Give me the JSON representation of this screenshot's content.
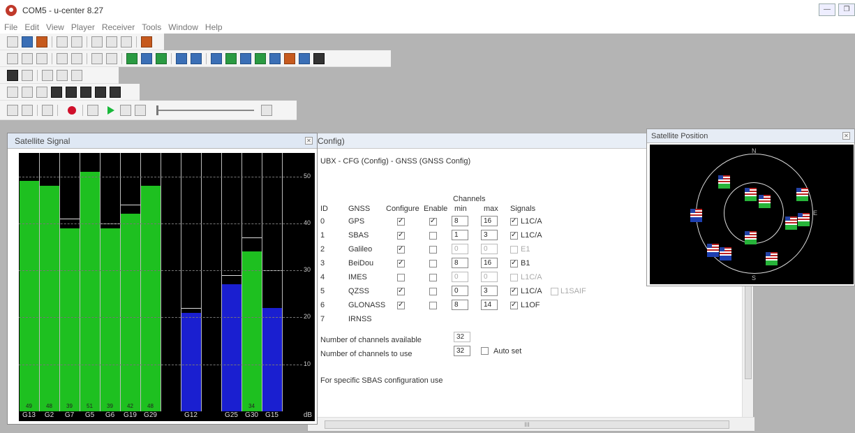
{
  "window": {
    "title": "COM5 - u-center 8.27"
  },
  "menu": [
    "File",
    "Edit",
    "View",
    "Player",
    "Receiver",
    "Tools",
    "Window",
    "Help"
  ],
  "config": {
    "title": "Config)",
    "heading": "UBX - CFG (Config) - GNSS (GNSS Config)",
    "channels_label": "Channels",
    "columns": [
      "ID",
      "GNSS",
      "Configure",
      "Enable",
      "min",
      "max",
      "Signals"
    ],
    "rows": [
      {
        "id": "0",
        "gnss": "GPS",
        "configure": true,
        "enable": true,
        "min": "8",
        "max": "16",
        "signal": "L1C/A",
        "signal_on": true,
        "disabled": false
      },
      {
        "id": "1",
        "gnss": "SBAS",
        "configure": true,
        "enable": false,
        "min": "1",
        "max": "3",
        "signal": "L1C/A",
        "signal_on": true,
        "disabled": false
      },
      {
        "id": "2",
        "gnss": "Galileo",
        "configure": true,
        "enable": false,
        "min": "0",
        "max": "0",
        "signal": "E1",
        "signal_on": false,
        "disabled": true
      },
      {
        "id": "3",
        "gnss": "BeiDou",
        "configure": true,
        "enable": false,
        "min": "8",
        "max": "16",
        "signal": "B1",
        "signal_on": true,
        "disabled": false
      },
      {
        "id": "4",
        "gnss": "IMES",
        "configure": false,
        "enable": false,
        "min": "0",
        "max": "0",
        "signal": "L1C/A",
        "signal_on": false,
        "disabled": true
      },
      {
        "id": "5",
        "gnss": "QZSS",
        "configure": true,
        "enable": false,
        "min": "0",
        "max": "3",
        "signal": "L1C/A",
        "signal_on": true,
        "disabled": false,
        "extra_signal": "L1SAIF"
      },
      {
        "id": "6",
        "gnss": "GLONASS",
        "configure": true,
        "enable": false,
        "min": "8",
        "max": "14",
        "signal": "L1OF",
        "signal_on": true,
        "disabled": false
      },
      {
        "id": "7",
        "gnss": "IRNSS",
        "configure": null,
        "enable": null,
        "min": null,
        "max": null,
        "signal": null,
        "disabled": false
      }
    ],
    "channels_available_label": "Number of channels available",
    "channels_available": "32",
    "channels_use_label": "Number of channels to use",
    "channels_use": "32",
    "auto_set_label": "Auto set",
    "sbas_note": "For specific SBAS configuration use",
    "hscroll_label": "III"
  },
  "signal": {
    "title": "Satellite Signal",
    "x_unit": "dB",
    "y_ticks": [
      "50",
      "40",
      "30",
      "20",
      "10"
    ]
  },
  "position": {
    "title": "Satellite Position",
    "dirs": {
      "n": "N",
      "e": "E",
      "s": "S"
    }
  },
  "chart_data": {
    "type": "bar",
    "categories": [
      "G13",
      "G2",
      "G7",
      "G5",
      "G6",
      "G19",
      "G29",
      "",
      "G12",
      "",
      "G25",
      "G30",
      "G15",
      ""
    ],
    "values": [
      49,
      48,
      39,
      51,
      39,
      42,
      48,
      null,
      21,
      null,
      27,
      34,
      22,
      null
    ],
    "peak": [
      null,
      null,
      41,
      null,
      40,
      44,
      null,
      null,
      22,
      null,
      29,
      37,
      30,
      null
    ],
    "colors": [
      "#1ec020",
      "#1ec020",
      "#1ec020",
      "#1ec020",
      "#1ec020",
      "#1ec020",
      "#1ec020",
      null,
      "#1a1fd0",
      null,
      "#1a1fd0",
      "#1ec020",
      "#1a1fd0",
      null
    ],
    "labels": [
      "49",
      "48",
      "39",
      "51",
      "39",
      "42",
      "48",
      "",
      "",
      "",
      "",
      "34",
      "",
      ""
    ],
    "ylim": [
      0,
      55
    ],
    "y_ticks": [
      10,
      20,
      30,
      40,
      50
    ],
    "grid": true
  }
}
